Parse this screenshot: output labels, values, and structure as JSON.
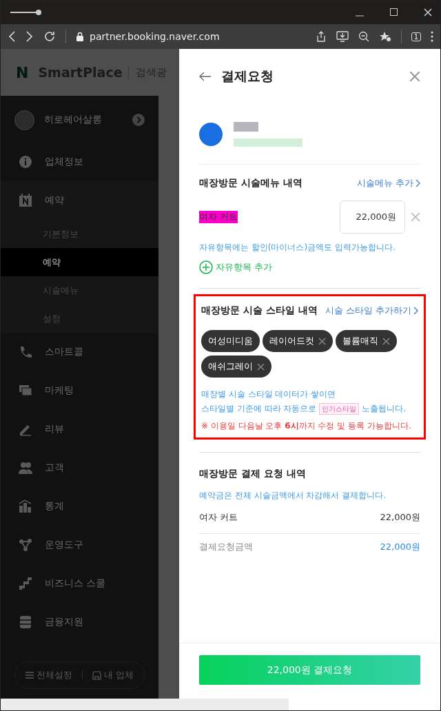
{
  "browser": {
    "url": "partner.booking.naver.com",
    "tab_count": "1"
  },
  "header": {
    "logo_mark": "N",
    "logo_text": "SmartPlace",
    "nav_item": "검색광"
  },
  "sidebar": {
    "profile": {
      "name": "히로헤어살롱"
    },
    "items": [
      {
        "label": "업체정보"
      },
      {
        "label": "예약",
        "children": [
          {
            "label": "기본정보",
            "selected": false
          },
          {
            "label": "예약",
            "selected": true
          },
          {
            "label": "시술메뉴",
            "selected": false
          },
          {
            "label": "설정",
            "selected": false
          }
        ]
      },
      {
        "label": "스마트콜"
      },
      {
        "label": "마케팅"
      },
      {
        "label": "리뷰"
      },
      {
        "label": "고객"
      },
      {
        "label": "통계"
      },
      {
        "label": "운영도구"
      },
      {
        "label": "비즈니스 스쿨"
      },
      {
        "label": "금융지원"
      }
    ],
    "footer": [
      "전체설정",
      "내 업체"
    ]
  },
  "drawer": {
    "title": "결제요청",
    "menu_section": {
      "title": "매장방문 시술메뉴 내역",
      "add_link": "시술메뉴 추가",
      "items": [
        {
          "name": "여자 커트",
          "highlighted": true,
          "price": "22,000원"
        }
      ],
      "hint": "자유항목에는 할인(마이너스)금액도 입력가능합니다.",
      "add_free": "자유항목 추가"
    },
    "style_section": {
      "title": "매장방문 시술 스타일 내역",
      "add_link": "시술 스타일 추가하기",
      "annotated": true,
      "chips": [
        {
          "label": "여성미디움",
          "removable": false
        },
        {
          "label": "레이어드컷",
          "removable": true
        },
        {
          "label": "볼륨매직",
          "removable": true
        },
        {
          "label": "애쉬그레이",
          "removable": true
        }
      ],
      "info_line1": "매장별 시술 스타일 데이터가 쌓이면",
      "info_line2_before": "스타일별 기준에 따라 자동으로",
      "info_badge": "인기스타일",
      "info_line2_after": "노출됩니다.",
      "notice": "※ 이용일 다음날 오후 **6시**까지 수정 및 등록 가능합니다."
    },
    "payment_section": {
      "title": "매장방문 결제 요청 내역",
      "note": "예약금은 전체 시술금액에서 차감해서 결제합니다.",
      "rows": [
        {
          "label": "여자 커트",
          "amount": "22,000원"
        }
      ],
      "total_label": "결제요청금액",
      "total_amount": "22,000원"
    },
    "submit": "22,000원 결제요청"
  }
}
